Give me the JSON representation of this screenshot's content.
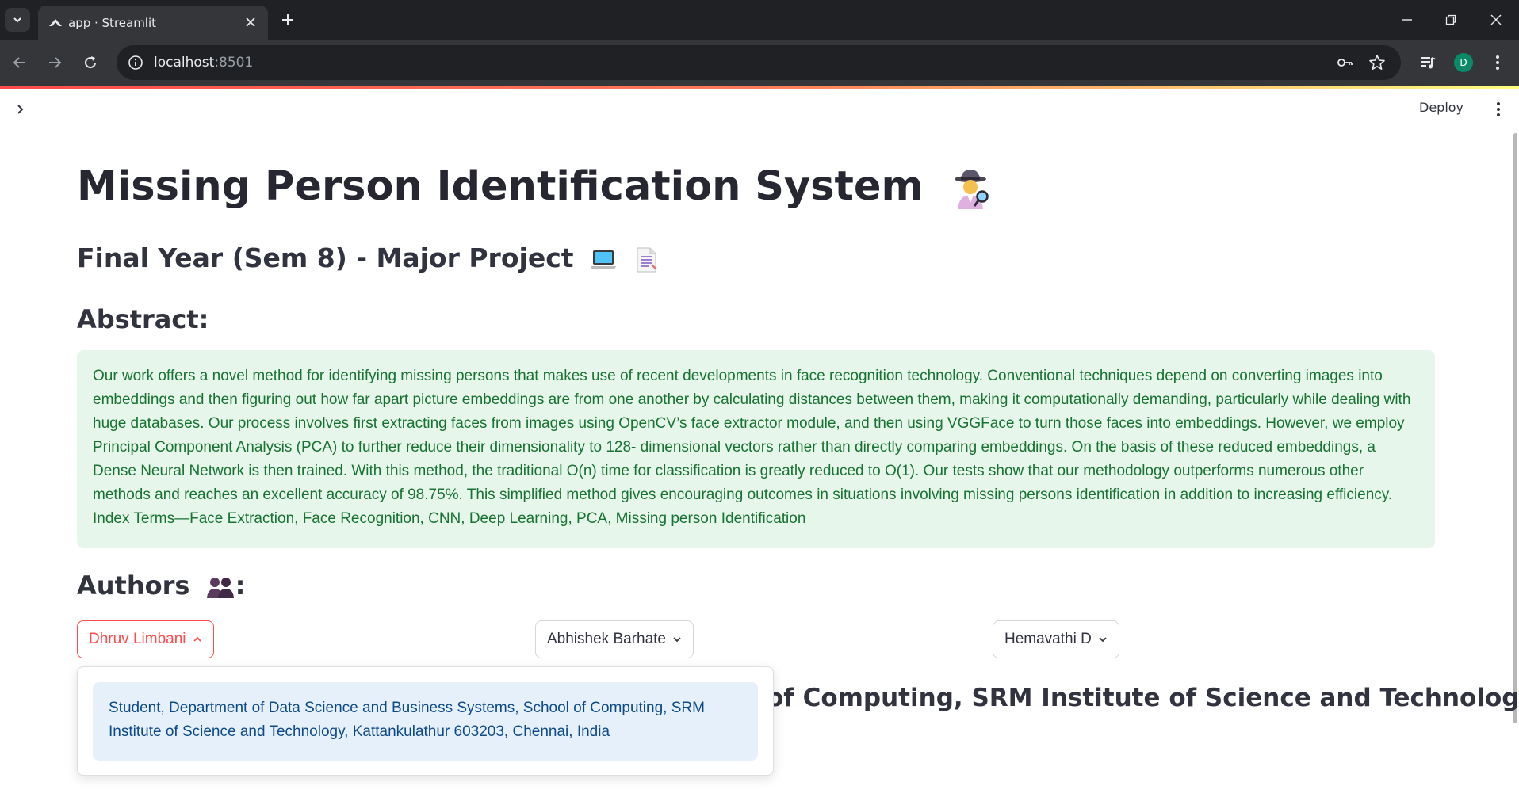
{
  "browser": {
    "tab_title": "app · Streamlit",
    "url_host": "localhost",
    "url_port": ":8501",
    "profile_initial": "D"
  },
  "header": {
    "deploy_label": "Deploy"
  },
  "page": {
    "title": "Missing Person Identification System",
    "subtitle": "Final Year (Sem 8) - Major Project",
    "abstract_heading": "Abstract:",
    "abstract_text": "Our work offers a novel method for identifying missing persons that makes use of recent developments in face recognition technology. Conventional techniques depend on converting images into embeddings and then figuring out how far apart picture embeddings are from one another by calculating distances between them, making it computationally demanding, particularly while dealing with huge databases. Our process involves first extracting faces from images using OpenCV’s face extractor module, and then using VGGFace to turn those faces into embeddings. However, we employ Principal Component Analysis (PCA) to further reduce their dimensionality to 128- dimensional vectors rather than directly comparing embeddings. On the basis of these reduced embeddings, a Dense Neural Network is then trained. With this method, the traditional O(n) time for classification is greatly reduced to O(1). Our tests show that our methodology outperforms numerous other methods and reaches an excellent accuracy of 98.75%. This simplified method gives encouraging outcomes in situations involving missing persons identification in addition to increasing efficiency. Index Terms—Face Extraction, Face Recognition, CNN, Deep Learning, PCA, Missing person Identification",
    "authors_heading": "Authors",
    "authors_colon": ":",
    "authors": [
      {
        "name": "Dhruv Limbani",
        "expanded": true
      },
      {
        "name": "Abhishek Barhate",
        "expanded": false
      },
      {
        "name": "Hemavathi D",
        "expanded": false
      }
    ],
    "popover_text": "Student, Department of Data Science and Business Systems, School of Computing, SRM Institute of Science and Technology, Kattankulathur 603203, Chennai, India",
    "behind_text": "of Computing, SRM Institute of Science and Technology,"
  },
  "colors": {
    "accent": "#ff4b4b",
    "success_bg": "#e6f6ea",
    "success_text": "#177233",
    "info_bg": "#e6f0fa",
    "info_text": "#0d4a8a"
  }
}
